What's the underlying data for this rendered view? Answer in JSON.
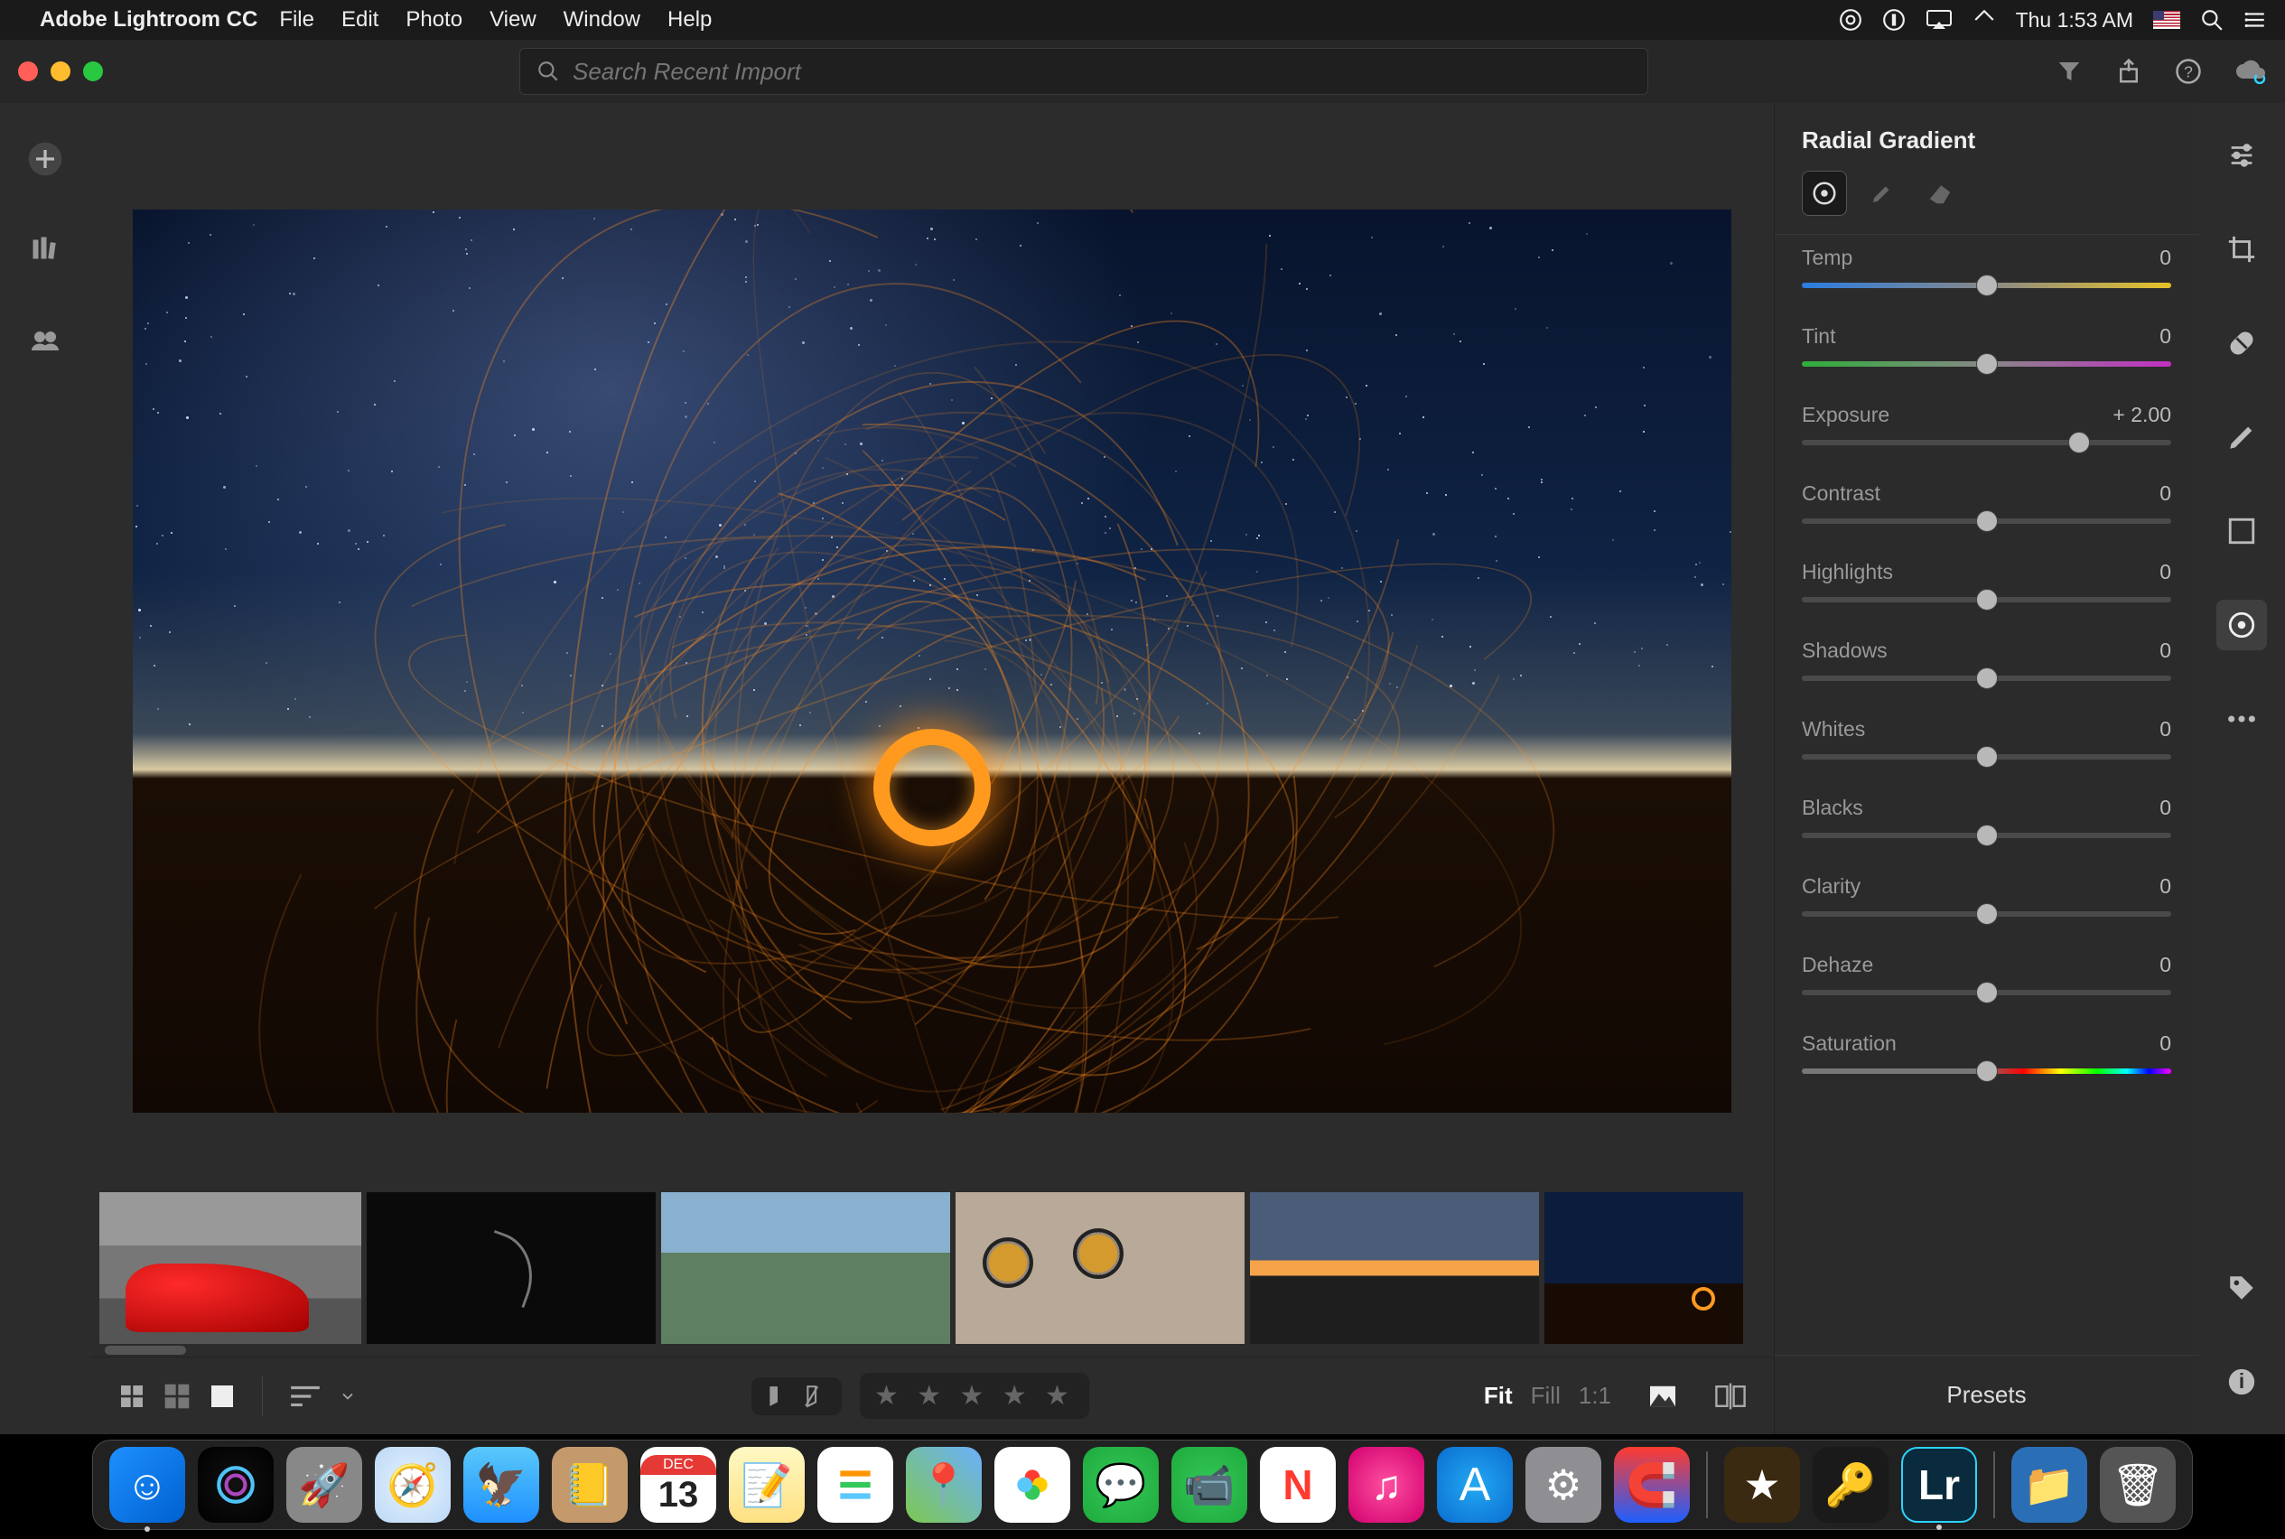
{
  "menubar": {
    "app_name": "Adobe Lightroom CC",
    "items": [
      "File",
      "Edit",
      "Photo",
      "View",
      "Window",
      "Help"
    ],
    "clock": "Thu 1:53 AM"
  },
  "titlebar": {
    "search_placeholder": "Search Recent Import"
  },
  "panel": {
    "title": "Radial Gradient",
    "sliders": [
      {
        "name": "Temp",
        "value": "0",
        "pos": 50,
        "track": "temp"
      },
      {
        "name": "Tint",
        "value": "0",
        "pos": 50,
        "track": "tint"
      },
      {
        "name": "Exposure",
        "value": "+ 2.00",
        "pos": 75,
        "track": "plain"
      },
      {
        "name": "Contrast",
        "value": "0",
        "pos": 50,
        "track": "plain"
      },
      {
        "name": "Highlights",
        "value": "0",
        "pos": 50,
        "track": "plain"
      },
      {
        "name": "Shadows",
        "value": "0",
        "pos": 50,
        "track": "plain"
      },
      {
        "name": "Whites",
        "value": "0",
        "pos": 50,
        "track": "plain"
      },
      {
        "name": "Blacks",
        "value": "0",
        "pos": 50,
        "track": "plain"
      },
      {
        "name": "Clarity",
        "value": "0",
        "pos": 50,
        "track": "plain"
      },
      {
        "name": "Dehaze",
        "value": "0",
        "pos": 50,
        "track": "plain"
      },
      {
        "name": "Saturation",
        "value": "0",
        "pos": 50,
        "track": "sat"
      }
    ],
    "presets": "Presets"
  },
  "bottombar": {
    "zoom": {
      "fit": "Fit",
      "fill": "Fill",
      "one": "1:1"
    }
  },
  "calendar": {
    "month": "DEC",
    "day": "13"
  },
  "dock_lr": "Lr"
}
